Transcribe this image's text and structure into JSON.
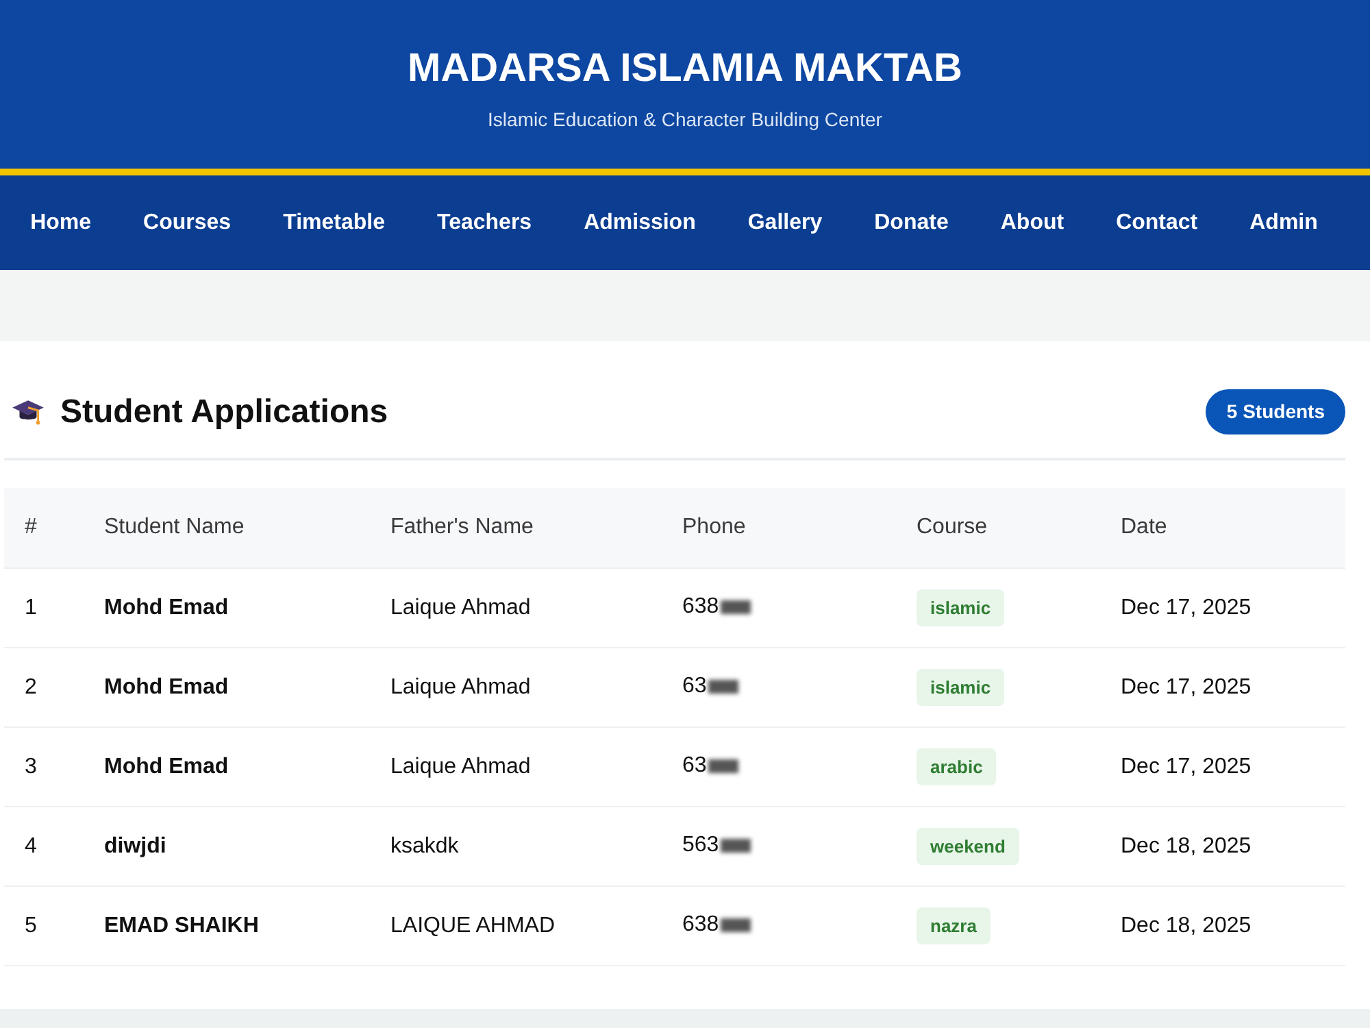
{
  "header": {
    "title": "MADARSA ISLAMIA MAKTAB",
    "subtitle": "Islamic Education & Character Building Center"
  },
  "nav": {
    "items": [
      "Home",
      "Courses",
      "Timetable",
      "Teachers",
      "Admission",
      "Gallery",
      "Donate",
      "About",
      "Contact",
      "Admin"
    ]
  },
  "applications": {
    "title": "Student Applications",
    "count_badge": "5 Students",
    "table": {
      "columns": [
        "#",
        "Student Name",
        "Father's Name",
        "Phone",
        "Course",
        "Date"
      ],
      "rows": [
        {
          "number": "1",
          "student_name": "Mohd Emad",
          "father_name": "Laique Ahmad",
          "phone": "638",
          "redacted": true,
          "course": "islamic",
          "date": "Dec 17, 2025"
        },
        {
          "number": "2",
          "student_name": "Mohd Emad",
          "father_name": "Laique Ahmad",
          "phone": "63",
          "redacted": true,
          "course": "islamic",
          "date": "Dec 17, 2025"
        },
        {
          "number": "3",
          "student_name": "Mohd Emad",
          "father_name": "Laique Ahmad",
          "phone": "63",
          "redacted": true,
          "course": "arabic",
          "date": "Dec 17, 2025"
        },
        {
          "number": "4",
          "student_name": "diwjdi",
          "father_name": "ksakdk",
          "phone": "563",
          "redacted": true,
          "course": "weekend",
          "date": "Dec 18, 2025"
        },
        {
          "number": "5",
          "student_name": "EMAD SHAIKH",
          "father_name": "LAIQUE AHMAD",
          "phone": "638",
          "redacted": true,
          "course": "nazra",
          "date": "Dec 18, 2025"
        }
      ]
    }
  }
}
